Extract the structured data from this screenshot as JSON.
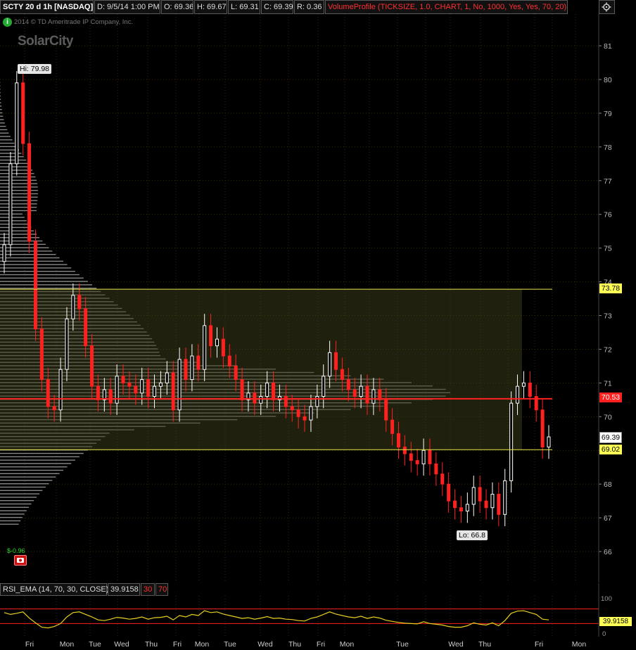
{
  "header": {
    "symbol": "SCTY 20 d 1h [NASDAQ]",
    "date": "D: 9/5/14 1:00 PM",
    "open": "O: 69.36",
    "high": "H: 69.67",
    "low": "L: 69.31",
    "close": "C: 69.39",
    "range": "R: 0.36",
    "study": "VolumeProfile (TICKSIZE, 1.0, CHART, 1, No, 1000, Yes, Yes, 70, 20)"
  },
  "watermark": {
    "copyright": "2014 © TD Ameritrade IP Company, Inc.",
    "company": "SolarCity"
  },
  "change_label": "$-0.96",
  "colors": {
    "up": "#ffffff",
    "down": "#ff2020",
    "poc": "#ff2020",
    "value_area": "#e8e84a",
    "rsi": "#e8d020",
    "grid": "#3a2a00",
    "profile": "#b4b4b4"
  },
  "chart_data": [
    {
      "type": "candlestick",
      "name": "SCTY 20 d 1h",
      "ylim": [
        65,
        82
      ],
      "y_ticks": [
        66,
        67,
        68,
        69,
        70,
        71,
        72,
        73,
        74,
        75,
        76,
        77,
        78,
        79,
        80,
        81
      ],
      "x_day_labels": [
        "Fri",
        "Mon",
        "Tue",
        "Wed",
        "Thu",
        "Fri",
        "Mon",
        "Tue",
        "Wed",
        "Thu",
        "Fri",
        "Mon",
        "Tue",
        "Wed",
        "Thu",
        "Fri",
        "Mon"
      ],
      "hi_label": "Hi: 79.98",
      "lo_label": "Lo: 66.8",
      "price_labels": {
        "value_area_high": "73.78",
        "poc": "70.53",
        "last": "69.39",
        "value_area_low": "69.02"
      },
      "levels": {
        "value_area_high": 73.78,
        "poc": 70.53,
        "value_area_low": 69.02,
        "last": 69.39
      },
      "closes": [
        75.1,
        77.5,
        79.9,
        78.1,
        75.2,
        72.6,
        71.1,
        70.3,
        70.2,
        71.4,
        72.9,
        73.6,
        73.2,
        72.1,
        70.9,
        70.5,
        70.8,
        70.4,
        71.2,
        71.0,
        70.9,
        70.7,
        71.1,
        70.6,
        70.9,
        71.0,
        71.3,
        70.2,
        71.7,
        71.1,
        71.8,
        71.4,
        72.7,
        72.1,
        72.3,
        71.8,
        71.5,
        71.1,
        70.5,
        70.7,
        70.4,
        70.6,
        71.0,
        70.5,
        70.6,
        70.3,
        70.2,
        70.0,
        69.9,
        70.3,
        70.6,
        71.2,
        71.9,
        71.4,
        71.1,
        70.8,
        70.6,
        70.9,
        70.4,
        70.8,
        70.5,
        69.9,
        69.5,
        69.1,
        68.9,
        68.7,
        68.6,
        69.0,
        68.6,
        68.3,
        68.0,
        67.5,
        67.3,
        67.2,
        67.4,
        67.9,
        67.5,
        67.3,
        67.7,
        67.1,
        68.1,
        70.4,
        70.9,
        71.0,
        70.6,
        70.2,
        69.1,
        69.4
      ]
    },
    {
      "type": "line",
      "name": "RSI_EMA (14, 70, 30, CLOSE)",
      "legend": {
        "label": "RSI_EMA (14, 70, 30, CLOSE)",
        "value": "39.9158",
        "overbought": "30",
        "oversold": "70"
      },
      "ylim": [
        0,
        100
      ],
      "y_ticks": [
        "100",
        "0"
      ],
      "levels": [
        70,
        30
      ],
      "last_label": "39.9158",
      "values": [
        60,
        55,
        58,
        62,
        45,
        32,
        20,
        18,
        22,
        30,
        48,
        60,
        62,
        55,
        48,
        40,
        38,
        42,
        47,
        45,
        42,
        44,
        48,
        42,
        46,
        47,
        50,
        40,
        52,
        48,
        55,
        52,
        65,
        60,
        62,
        56,
        52,
        48,
        44,
        46,
        42,
        45,
        49,
        44,
        45,
        42,
        41,
        38,
        37,
        44,
        48,
        55,
        62,
        56,
        52,
        48,
        46,
        50,
        44,
        48,
        45,
        39,
        36,
        33,
        31,
        30,
        29,
        35,
        30,
        28,
        26,
        22,
        20,
        20,
        24,
        32,
        28,
        26,
        32,
        24,
        38,
        58,
        64,
        65,
        60,
        55,
        42,
        40
      ]
    }
  ]
}
